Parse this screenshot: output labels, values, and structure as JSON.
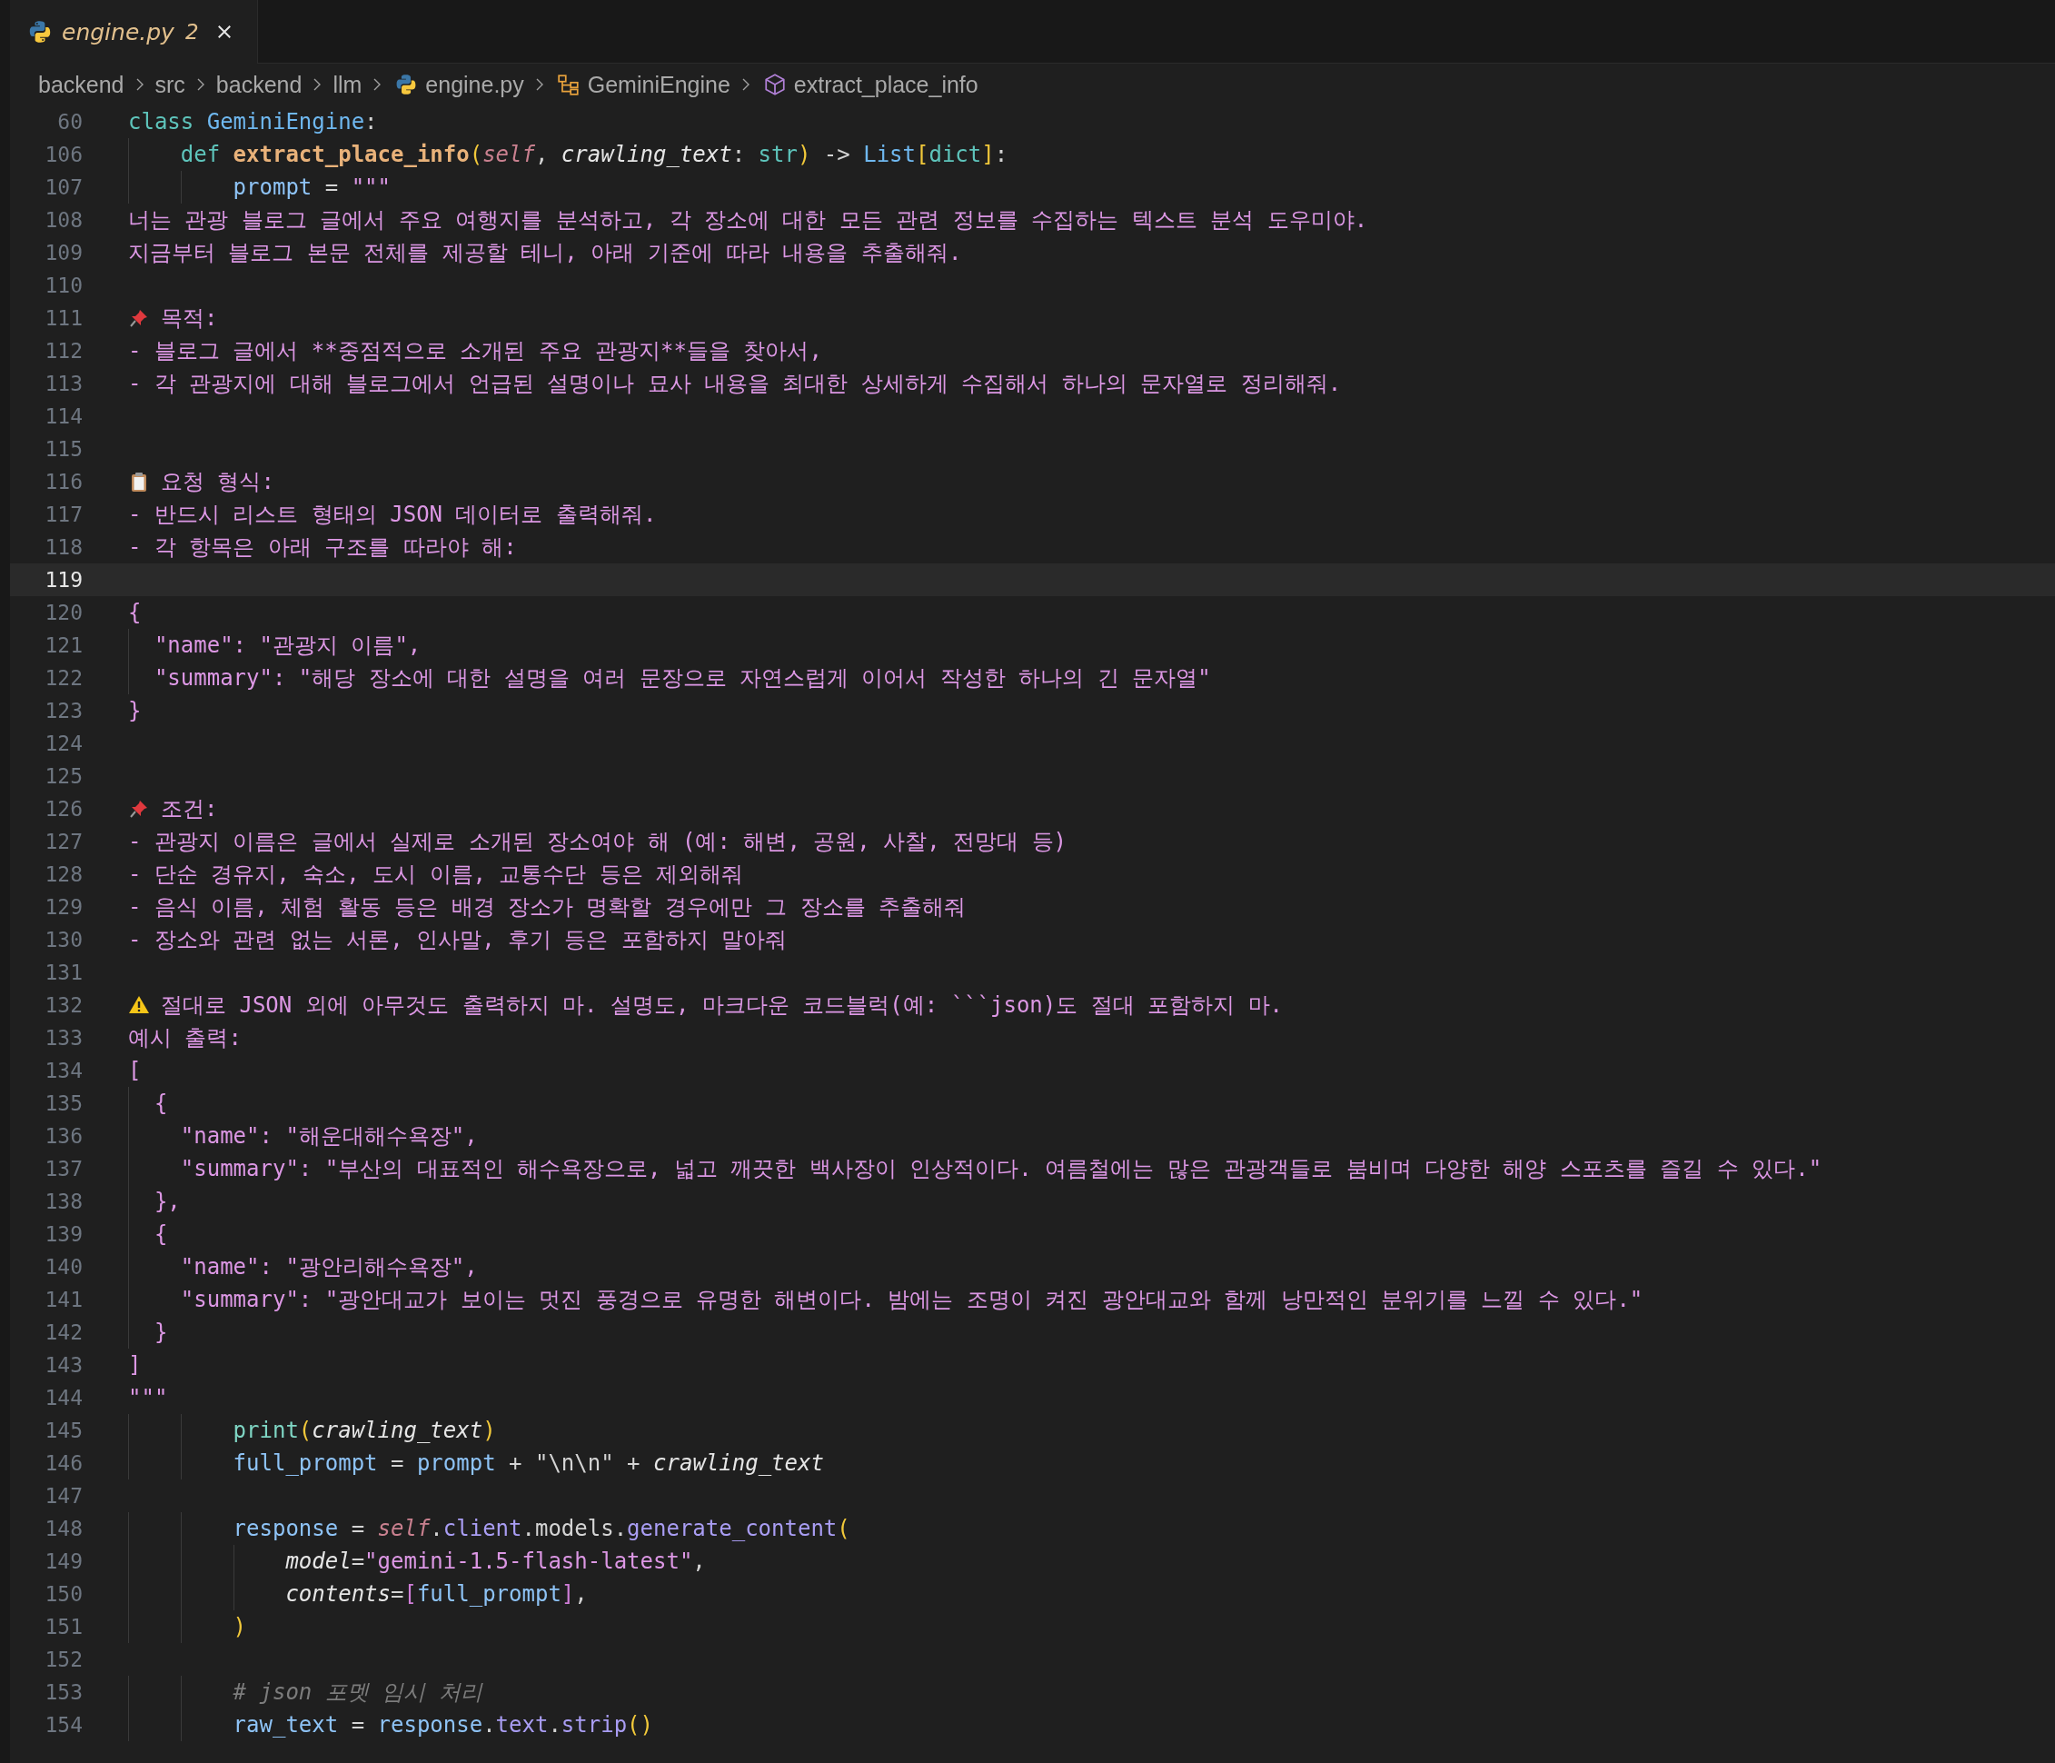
{
  "tab": {
    "filename": "engine.py",
    "problems": "2",
    "kind": "warning"
  },
  "breadcrumb": [
    {
      "label": "backend",
      "kind": "folder"
    },
    {
      "label": "src",
      "kind": "folder"
    },
    {
      "label": "backend",
      "kind": "folder"
    },
    {
      "label": "llm",
      "kind": "folder"
    },
    {
      "label": "engine.py",
      "kind": "file"
    },
    {
      "label": "GeminiEngine",
      "kind": "class"
    },
    {
      "label": "extract_place_info",
      "kind": "method"
    }
  ],
  "lines": [
    {
      "n": "60",
      "current": false,
      "kind": "code",
      "tokens": [
        {
          "t": "class ",
          "kind": "kw"
        },
        {
          "t": "GeminiEngine",
          "kind": "cls"
        },
        {
          "t": ":",
          "kind": "plain"
        }
      ]
    },
    {
      "n": "106",
      "current": false,
      "kind": "code",
      "tokens": [
        {
          "t": "    def ",
          "kind": "kw"
        },
        {
          "t": "extract_place_info",
          "kind": "fn"
        },
        {
          "t": "(",
          "kind": "paren"
        },
        {
          "t": "self",
          "kind": "self"
        },
        {
          "t": ", ",
          "kind": "plain"
        },
        {
          "t": "crawling_text",
          "kind": "param"
        },
        {
          "t": ": ",
          "kind": "plain"
        },
        {
          "t": "str",
          "kind": "type"
        },
        {
          "t": ")",
          "kind": "paren"
        },
        {
          "t": " -> ",
          "kind": "plain"
        },
        {
          "t": "List",
          "kind": "cls"
        },
        {
          "t": "[",
          "kind": "paren"
        },
        {
          "t": "dict",
          "kind": "type"
        },
        {
          "t": "]",
          "kind": "paren"
        },
        {
          "t": ":",
          "kind": "plain"
        }
      ]
    },
    {
      "n": "107",
      "current": false,
      "kind": "code",
      "tokens": [
        {
          "t": "        prompt",
          "kind": "var"
        },
        {
          "t": " = ",
          "kind": "plain"
        },
        {
          "t": "\"\"\"",
          "kind": "str"
        }
      ]
    },
    {
      "n": "108",
      "current": false,
      "kind": "code",
      "tokens": [
        {
          "t": "너는 관광 블로그 글에서 주요 여행지를 분석하고, 각 장소에 대한 모든 관련 정보를 수집하는 텍스트 분석 도우미야.",
          "kind": "str"
        }
      ]
    },
    {
      "n": "109",
      "current": false,
      "kind": "code",
      "tokens": [
        {
          "t": "지금부터 블로그 본문 전체를 제공할 테니, 아래 기준에 따라 내용을 추출해줘.",
          "kind": "str"
        }
      ]
    },
    {
      "n": "110",
      "current": false,
      "kind": "code"
    },
    {
      "n": "111",
      "current": false,
      "kind": "pin",
      "tokens": [
        {
          "t": "목적:",
          "kind": "str"
        }
      ]
    },
    {
      "n": "112",
      "current": false,
      "kind": "code",
      "tokens": [
        {
          "t": "- 블로그 글에서 **중점적으로 소개된 주요 관광지**들을 찾아서,",
          "kind": "str"
        }
      ]
    },
    {
      "n": "113",
      "current": false,
      "kind": "code",
      "tokens": [
        {
          "t": "- 각 관광지에 대해 블로그에서 언급된 설명이나 묘사 내용을 최대한 상세하게 수집해서 하나의 문자열로 정리해줘.",
          "kind": "str"
        }
      ]
    },
    {
      "n": "114",
      "current": false,
      "kind": "code"
    },
    {
      "n": "115",
      "current": false,
      "kind": "code"
    },
    {
      "n": "116",
      "current": false,
      "kind": "clipboard",
      "tokens": [
        {
          "t": "요청 형식:",
          "kind": "str"
        }
      ]
    },
    {
      "n": "117",
      "current": false,
      "kind": "code",
      "tokens": [
        {
          "t": "- 반드시 리스트 형태의 JSON 데이터로 출력해줘.",
          "kind": "str"
        }
      ]
    },
    {
      "n": "118",
      "current": false,
      "kind": "code",
      "tokens": [
        {
          "t": "- 각 항목은 아래 구조를 따라야 해:",
          "kind": "str"
        }
      ]
    },
    {
      "n": "119",
      "current": true,
      "kind": "code"
    },
    {
      "n": "120",
      "current": false,
      "kind": "code",
      "tokens": [
        {
          "t": "{",
          "kind": "str"
        }
      ]
    },
    {
      "n": "121",
      "current": false,
      "kind": "code",
      "tokens": [
        {
          "t": "  \"name\": \"관광지 이름\",",
          "kind": "str"
        }
      ]
    },
    {
      "n": "122",
      "current": false,
      "kind": "code",
      "tokens": [
        {
          "t": "  \"summary\": \"해당 장소에 대한 설명을 여러 문장으로 자연스럽게 이어서 작성한 하나의 긴 문자열\"",
          "kind": "str"
        }
      ]
    },
    {
      "n": "123",
      "current": false,
      "kind": "code",
      "tokens": [
        {
          "t": "}",
          "kind": "str"
        }
      ]
    },
    {
      "n": "124",
      "current": false,
      "kind": "code"
    },
    {
      "n": "125",
      "current": false,
      "kind": "code"
    },
    {
      "n": "126",
      "current": false,
      "kind": "pin",
      "tokens": [
        {
          "t": "조건:",
          "kind": "str"
        }
      ]
    },
    {
      "n": "127",
      "current": false,
      "kind": "code",
      "tokens": [
        {
          "t": "- 관광지 이름은 글에서 실제로 소개된 장소여야 해 (예: 해변, 공원, 사찰, 전망대 등)",
          "kind": "str"
        }
      ]
    },
    {
      "n": "128",
      "current": false,
      "kind": "code",
      "tokens": [
        {
          "t": "- 단순 경유지, 숙소, 도시 이름, 교통수단 등은 제외해줘",
          "kind": "str"
        }
      ]
    },
    {
      "n": "129",
      "current": false,
      "kind": "code",
      "tokens": [
        {
          "t": "- 음식 이름, 체험 활동 등은 배경 장소가 명확할 경우에만 그 장소를 추출해줘",
          "kind": "str"
        }
      ]
    },
    {
      "n": "130",
      "current": false,
      "kind": "code",
      "tokens": [
        {
          "t": "- 장소와 관련 없는 서론, 인사말, 후기 등은 포함하지 말아줘",
          "kind": "str"
        }
      ]
    },
    {
      "n": "131",
      "current": false,
      "kind": "code"
    },
    {
      "n": "132",
      "current": false,
      "kind": "warning",
      "tokens": [
        {
          "t": "절대로 JSON 외에 아무것도 출력하지 마. 설명도, 마크다운 코드블럭(예: ```json)도 절대 포함하지 마.",
          "kind": "str"
        }
      ]
    },
    {
      "n": "133",
      "current": false,
      "kind": "code",
      "tokens": [
        {
          "t": "예시 출력:",
          "kind": "str"
        }
      ]
    },
    {
      "n": "134",
      "current": false,
      "kind": "code",
      "tokens": [
        {
          "t": "[",
          "kind": "str"
        }
      ]
    },
    {
      "n": "135",
      "current": false,
      "kind": "code",
      "tokens": [
        {
          "t": "  {",
          "kind": "str"
        }
      ]
    },
    {
      "n": "136",
      "current": false,
      "kind": "code",
      "tokens": [
        {
          "t": "    \"name\": \"해운대해수욕장\",",
          "kind": "str"
        }
      ]
    },
    {
      "n": "137",
      "current": false,
      "kind": "code",
      "tokens": [
        {
          "t": "    \"summary\": \"부산의 대표적인 해수욕장으로, 넓고 깨끗한 백사장이 인상적이다. 여름철에는 많은 관광객들로 붐비며 다양한 해양 스포츠를 즐길 수 있다.\"",
          "kind": "str"
        }
      ]
    },
    {
      "n": "138",
      "current": false,
      "kind": "code",
      "tokens": [
        {
          "t": "  },",
          "kind": "str"
        }
      ]
    },
    {
      "n": "139",
      "current": false,
      "kind": "code",
      "tokens": [
        {
          "t": "  {",
          "kind": "str"
        }
      ]
    },
    {
      "n": "140",
      "current": false,
      "kind": "code",
      "tokens": [
        {
          "t": "    \"name\": \"광안리해수욕장\",",
          "kind": "str"
        }
      ]
    },
    {
      "n": "141",
      "current": false,
      "kind": "code",
      "tokens": [
        {
          "t": "    \"summary\": \"광안대교가 보이는 멋진 풍경으로 유명한 해변이다. 밤에는 조명이 켜진 광안대교와 함께 낭만적인 분위기를 느낄 수 있다.\"",
          "kind": "str"
        }
      ]
    },
    {
      "n": "142",
      "current": false,
      "kind": "code",
      "tokens": [
        {
          "t": "  }",
          "kind": "str"
        }
      ]
    },
    {
      "n": "143",
      "current": false,
      "kind": "code",
      "tokens": [
        {
          "t": "]",
          "kind": "str"
        }
      ]
    },
    {
      "n": "144",
      "current": false,
      "kind": "code",
      "tokens": [
        {
          "t": "\"\"\"",
          "kind": "str"
        }
      ]
    },
    {
      "n": "145",
      "current": false,
      "kind": "code",
      "tokens": [
        {
          "t": "        print",
          "kind": "call"
        },
        {
          "t": "(",
          "kind": "paren"
        },
        {
          "t": "crawling_text",
          "kind": "param"
        },
        {
          "t": ")",
          "kind": "paren"
        }
      ]
    },
    {
      "n": "146",
      "current": false,
      "kind": "code",
      "tokens": [
        {
          "t": "        full_prompt",
          "kind": "var"
        },
        {
          "t": " = ",
          "kind": "plain"
        },
        {
          "t": "prompt",
          "kind": "var"
        },
        {
          "t": " + ",
          "kind": "plain"
        },
        {
          "t": "\"\\n\\n\"",
          "kind": "plain"
        },
        {
          "t": " + ",
          "kind": "plain"
        },
        {
          "t": "crawling_text",
          "kind": "param"
        }
      ]
    },
    {
      "n": "147",
      "current": false,
      "kind": "code"
    },
    {
      "n": "148",
      "current": false,
      "kind": "code",
      "tokens": [
        {
          "t": "        response",
          "kind": "var"
        },
        {
          "t": " = ",
          "kind": "plain"
        },
        {
          "t": "self",
          "kind": "self"
        },
        {
          "t": ".",
          "kind": "plain"
        },
        {
          "t": "client",
          "kind": "prop"
        },
        {
          "t": ".models.",
          "kind": "plain"
        },
        {
          "t": "generate_content",
          "kind": "method"
        },
        {
          "t": "(",
          "kind": "paren"
        }
      ]
    },
    {
      "n": "149",
      "current": false,
      "kind": "code",
      "tokens": [
        {
          "t": "            model",
          "kind": "param"
        },
        {
          "t": "=",
          "kind": "plain"
        },
        {
          "t": "\"gemini-1.5-flash-latest\"",
          "kind": "str"
        },
        {
          "t": ",",
          "kind": "plain"
        }
      ]
    },
    {
      "n": "150",
      "current": false,
      "kind": "code",
      "tokens": [
        {
          "t": "            contents",
          "kind": "param"
        },
        {
          "t": "=",
          "kind": "plain"
        },
        {
          "t": "[",
          "kind": "bracket"
        },
        {
          "t": "full_prompt",
          "kind": "var"
        },
        {
          "t": "]",
          "kind": "bracket"
        },
        {
          "t": ",",
          "kind": "plain"
        }
      ]
    },
    {
      "n": "151",
      "current": false,
      "kind": "code",
      "tokens": [
        {
          "t": "        )",
          "kind": "paren"
        }
      ]
    },
    {
      "n": "152",
      "current": false,
      "kind": "code"
    },
    {
      "n": "153",
      "current": false,
      "kind": "code",
      "tokens": [
        {
          "t": "        # json 포멧 임시 처리",
          "kind": "comment"
        }
      ]
    },
    {
      "n": "154",
      "current": false,
      "kind": "code",
      "tokens": [
        {
          "t": "        raw_text",
          "kind": "var"
        },
        {
          "t": " = ",
          "kind": "plain"
        },
        {
          "t": "response",
          "kind": "var"
        },
        {
          "t": ".",
          "kind": "plain"
        },
        {
          "t": "text",
          "kind": "prop"
        },
        {
          "t": ".",
          "kind": "plain"
        },
        {
          "t": "strip",
          "kind": "method"
        },
        {
          "t": "()",
          "kind": "paren"
        }
      ]
    }
  ]
}
